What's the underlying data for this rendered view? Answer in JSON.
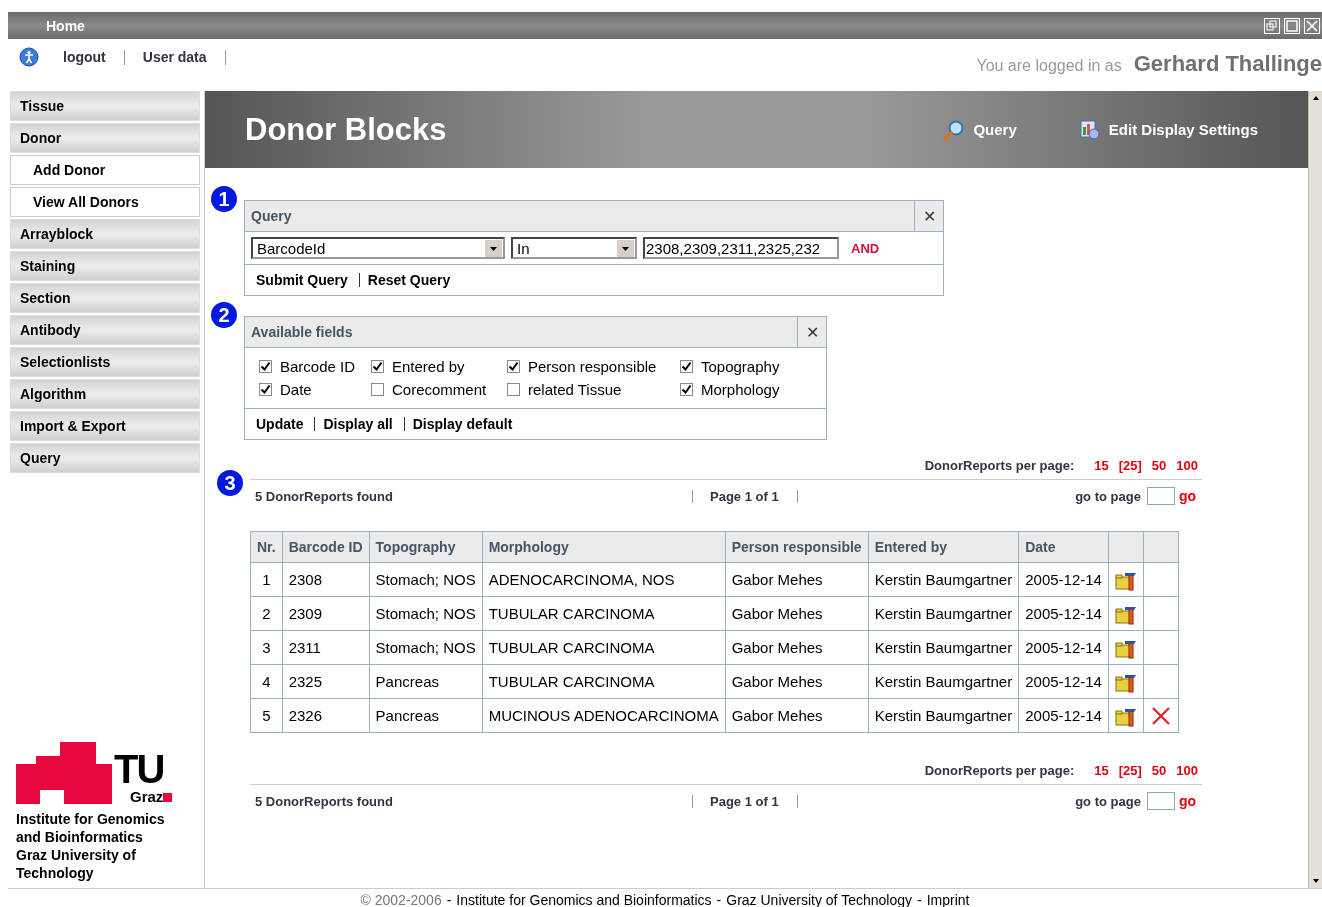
{
  "topbar": {
    "title": "Home"
  },
  "userbar": {
    "links": [
      "logout",
      "User data"
    ],
    "logged_in_label": "You are logged in as",
    "user_name": "Gerhard Thallinge"
  },
  "sidebar": {
    "items": [
      {
        "label": "Tissue",
        "kind": "section"
      },
      {
        "label": "Donor",
        "kind": "section"
      },
      {
        "label": "Add Donor",
        "kind": "sub"
      },
      {
        "label": "View All Donors",
        "kind": "sub"
      },
      {
        "label": "Arrayblock",
        "kind": "section"
      },
      {
        "label": "Staining",
        "kind": "section"
      },
      {
        "label": "Section",
        "kind": "section"
      },
      {
        "label": "Antibody",
        "kind": "section"
      },
      {
        "label": "Selectionlists",
        "kind": "section"
      },
      {
        "label": "Algorithm",
        "kind": "section"
      },
      {
        "label": "Import & Export",
        "kind": "section"
      },
      {
        "label": "Query",
        "kind": "section"
      }
    ],
    "logo": {
      "mark": "TU",
      "city": "Graz",
      "caption": "Institute for Genomics and Bioinformatics Graz University of Technology"
    }
  },
  "header": {
    "title": "Donor Blocks",
    "actions": [
      "Query",
      "Edit Display Settings"
    ]
  },
  "query_panel": {
    "step": "1",
    "title": "Query",
    "close": "✕",
    "field_select": "BarcodeId",
    "operator_select": "In",
    "value": "2308,2309,2311,2325,232",
    "connector": "AND",
    "links": [
      "Submit Query",
      "Reset Query"
    ]
  },
  "fields_panel": {
    "step": "2",
    "title": "Available fields",
    "close": "✕",
    "fields": [
      {
        "label": "Barcode ID",
        "checked": true
      },
      {
        "label": "Entered by",
        "checked": true
      },
      {
        "label": "Person responsible",
        "checked": true
      },
      {
        "label": "Topography",
        "checked": true
      },
      {
        "label": "Date",
        "checked": true
      },
      {
        "label": "Corecomment",
        "checked": false
      },
      {
        "label": "related Tissue",
        "checked": false
      },
      {
        "label": "Morphology",
        "checked": true
      }
    ],
    "links": [
      "Update",
      "Display all",
      "Display default"
    ]
  },
  "results": {
    "step": "3",
    "pagers": [
      {
        "per_page_label": "DonorReports per page:",
        "per_page_options": [
          "15",
          "[25]",
          "50",
          "100"
        ],
        "found": "5 DonorReports found",
        "page": "Page 1 of 1",
        "goto_label": "go to page",
        "go": "go"
      },
      {
        "per_page_label": "DonorReports per page:",
        "per_page_options": [
          "15",
          "[25]",
          "50",
          "100"
        ],
        "found": "5 DonorReports found",
        "page": "Page 1 of 1",
        "goto_label": "go to page",
        "go": "go"
      }
    ],
    "table": {
      "columns": [
        "Nr.",
        "Barcode ID",
        "Topography",
        "Morphology",
        "Person responsible",
        "Entered by",
        "Date"
      ],
      "rows": [
        {
          "cells": [
            "1",
            "2308",
            "Stomach; NOS",
            "ADENOCARCINOMA, NOS",
            "Gabor Mehes",
            "Kerstin Baumgartner",
            "2005-12-14"
          ],
          "deletable": false
        },
        {
          "cells": [
            "2",
            "2309",
            "Stomach; NOS",
            "TUBULAR CARCINOMA",
            "Gabor Mehes",
            "Kerstin Baumgartner",
            "2005-12-14"
          ],
          "deletable": false
        },
        {
          "cells": [
            "3",
            "2311",
            "Stomach; NOS",
            "TUBULAR CARCINOMA",
            "Gabor Mehes",
            "Kerstin Baumgartner",
            "2005-12-14"
          ],
          "deletable": false
        },
        {
          "cells": [
            "4",
            "2325",
            "Pancreas",
            "TUBULAR CARCINOMA",
            "Gabor Mehes",
            "Kerstin Baumgartner",
            "2005-12-14"
          ],
          "deletable": false
        },
        {
          "cells": [
            "5",
            "2326",
            "Pancreas",
            "MUCINOUS ADENOCARCINOMA",
            "Gabor Mehes",
            "Kerstin Baumgartner",
            "2005-12-14"
          ],
          "deletable": true
        }
      ]
    }
  },
  "footer": {
    "copyright": "© 2002-2006",
    "links": [
      "Institute for Genomics and Bioinformatics",
      "Graz University of Technology",
      "Imprint"
    ],
    "separator": "-"
  }
}
